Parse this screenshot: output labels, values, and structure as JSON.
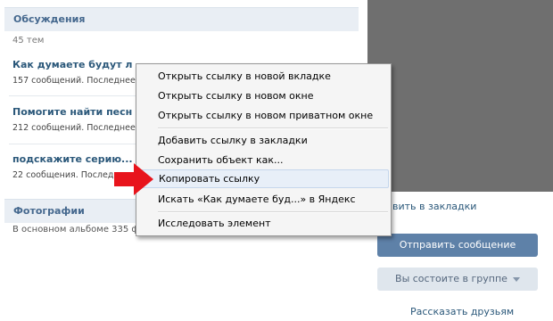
{
  "discussions": {
    "header": "Обсуждения",
    "count": "45 тем",
    "topics": [
      {
        "title": "Как думаете будут л",
        "meta": "157 сообщений. Последнее"
      },
      {
        "title": "Помогите найти песн",
        "meta": "212 сообщений. Последнее"
      },
      {
        "title": "подскажите серию...",
        "meta": "22 сообщения. Последнее"
      }
    ]
  },
  "photos": {
    "header": "Фотографии",
    "sub": "В основном альбоме 335 ф"
  },
  "sidebar": {
    "bookmark_link": "вить в закладки",
    "send_message": "Отправить сообщение",
    "member_status": "Вы состоите в группе",
    "tell_friends": "Рассказать друзьям"
  },
  "context_menu": {
    "items": [
      "Открыть ссылку в новой вкладке",
      "Открыть ссылку в новом окне",
      "Открыть ссылку в новом приватном окне",
      "Добавить ссылку в закладки",
      "Сохранить объект как...",
      "Копировать ссылку",
      "Искать «Как думаете буд...» в Яндекс",
      "Исследовать элемент"
    ],
    "highlighted_index": 5
  },
  "colors": {
    "header_bg": "#e9eef4",
    "link": "#2b587a",
    "primary_button": "#5e81a8",
    "secondary_button": "#dfe6ed",
    "arrow": "#e8141c"
  },
  "icons": [
    "red-arrow-icon",
    "dropdown-caret-icon"
  ]
}
